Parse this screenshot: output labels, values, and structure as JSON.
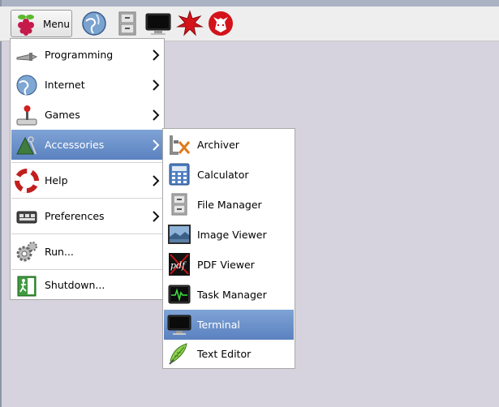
{
  "panel": {
    "menu_label": "Menu",
    "launchers": [
      "web-browser-icon",
      "file-manager-icon",
      "terminal-icon",
      "wolfram-mathematica-icon",
      "wolfram-language-icon"
    ]
  },
  "main_menu": {
    "items": [
      {
        "label": "Programming",
        "icon": "programming-icon",
        "submenu": true
      },
      {
        "label": "Internet",
        "icon": "internet-globe-icon",
        "submenu": true
      },
      {
        "label": "Games",
        "icon": "joystick-icon",
        "submenu": true
      },
      {
        "label": "Accessories",
        "icon": "accessories-icon",
        "submenu": true,
        "selected": true
      },
      {
        "label": "Help",
        "icon": "lifebuoy-icon",
        "submenu": true
      },
      {
        "label": "Preferences",
        "icon": "preferences-icon",
        "submenu": true
      },
      {
        "label": "Run...",
        "icon": "run-gears-icon",
        "submenu": false
      },
      {
        "label": "Shutdown...",
        "icon": "shutdown-exit-icon",
        "submenu": false
      }
    ]
  },
  "accessories_menu": {
    "items": [
      {
        "label": "Archiver",
        "icon": "archiver-icon"
      },
      {
        "label": "Calculator",
        "icon": "calculator-icon"
      },
      {
        "label": "File Manager",
        "icon": "file-manager-icon"
      },
      {
        "label": "Image Viewer",
        "icon": "image-viewer-icon"
      },
      {
        "label": "PDF Viewer",
        "icon": "pdf-viewer-icon"
      },
      {
        "label": "Task Manager",
        "icon": "task-manager-icon"
      },
      {
        "label": "Terminal",
        "icon": "terminal-icon",
        "selected": true
      },
      {
        "label": "Text Editor",
        "icon": "text-editor-icon"
      }
    ]
  },
  "colors": {
    "desktop": "#d6d2de",
    "selection": "#6b8fca",
    "panel": "#eeeeee"
  }
}
